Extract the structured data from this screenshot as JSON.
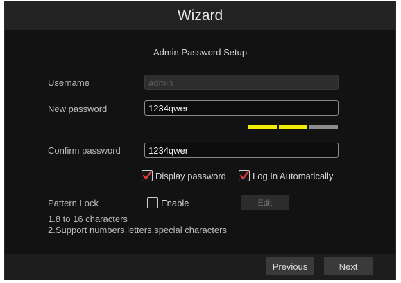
{
  "window": {
    "title": "Wizard"
  },
  "section": {
    "title": "Admin Password Setup"
  },
  "form": {
    "username_label": "Username",
    "username_value": "admin",
    "new_password_label": "New password",
    "new_password_value": "1234qwer",
    "confirm_password_label": "Confirm password",
    "confirm_password_value": "1234qwer"
  },
  "strength": {
    "levels": [
      "strong",
      "strong",
      "empty"
    ],
    "colors": {
      "active": "#f2f000",
      "inactive": "#8c8c8c"
    }
  },
  "options": {
    "display_password_label": "Display password",
    "display_password_checked": true,
    "auto_login_label": "Log In Automatically",
    "auto_login_checked": true
  },
  "pattern_lock": {
    "label": "Pattern Lock",
    "enable_label": "Enable",
    "enabled": false,
    "edit_label": "Edit"
  },
  "notes": {
    "line1": "1.8 to 16 characters",
    "line2": "2.Support numbers,letters,special characters"
  },
  "footer": {
    "previous_label": "Previous",
    "next_label": "Next"
  },
  "colors": {
    "check_mark": "#e0383b"
  }
}
